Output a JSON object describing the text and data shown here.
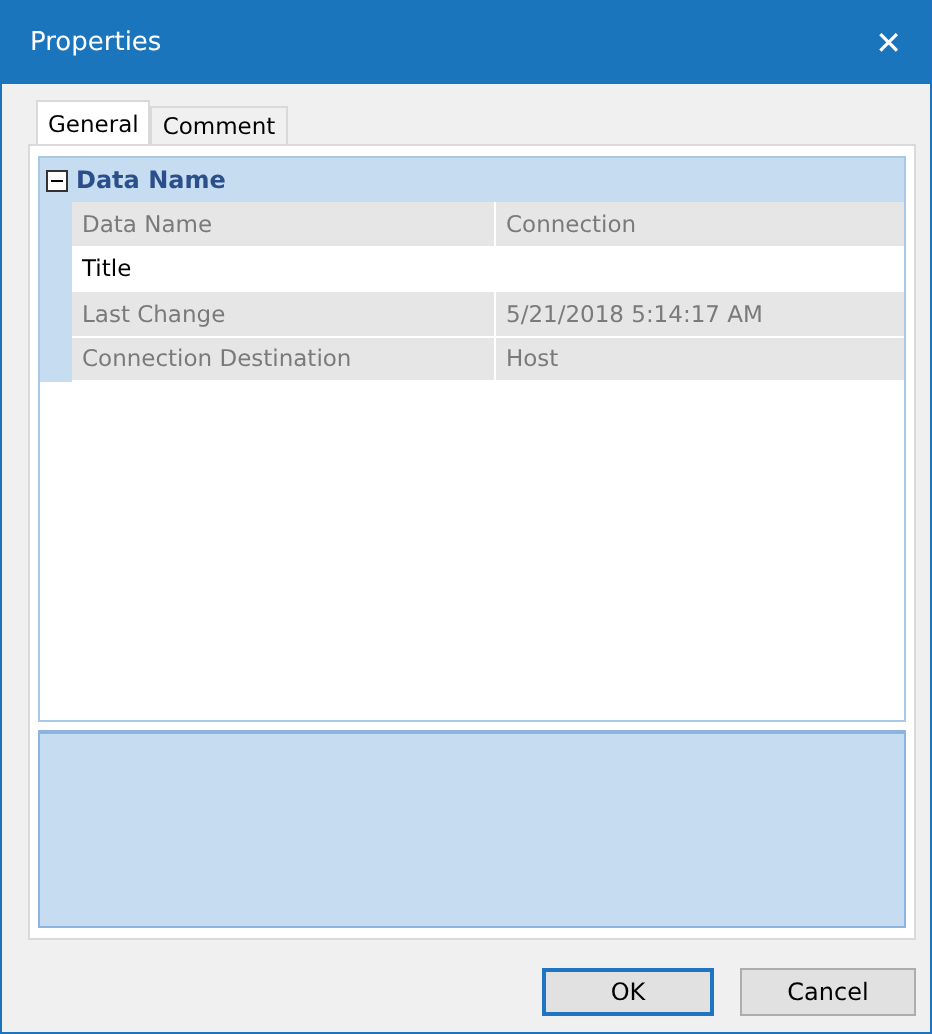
{
  "window": {
    "title": "Properties",
    "close": "✕"
  },
  "tabs": [
    {
      "label": "General",
      "selected": true
    },
    {
      "label": "Comment",
      "selected": false
    }
  ],
  "grid": {
    "category": {
      "label": "Data Name",
      "expanded": true
    },
    "rows": [
      {
        "name": "Data Name",
        "value": "Connection",
        "selected": false
      },
      {
        "name": "Title",
        "value": "",
        "selected": true
      },
      {
        "name": "Last Change",
        "value": "5/21/2018 5:14:17 AM",
        "selected": false
      },
      {
        "name": "Connection Destination",
        "value": "Host",
        "selected": false
      }
    ]
  },
  "buttons": [
    {
      "label": "OK",
      "default": true
    },
    {
      "label": "Cancel",
      "default": false
    }
  ]
}
